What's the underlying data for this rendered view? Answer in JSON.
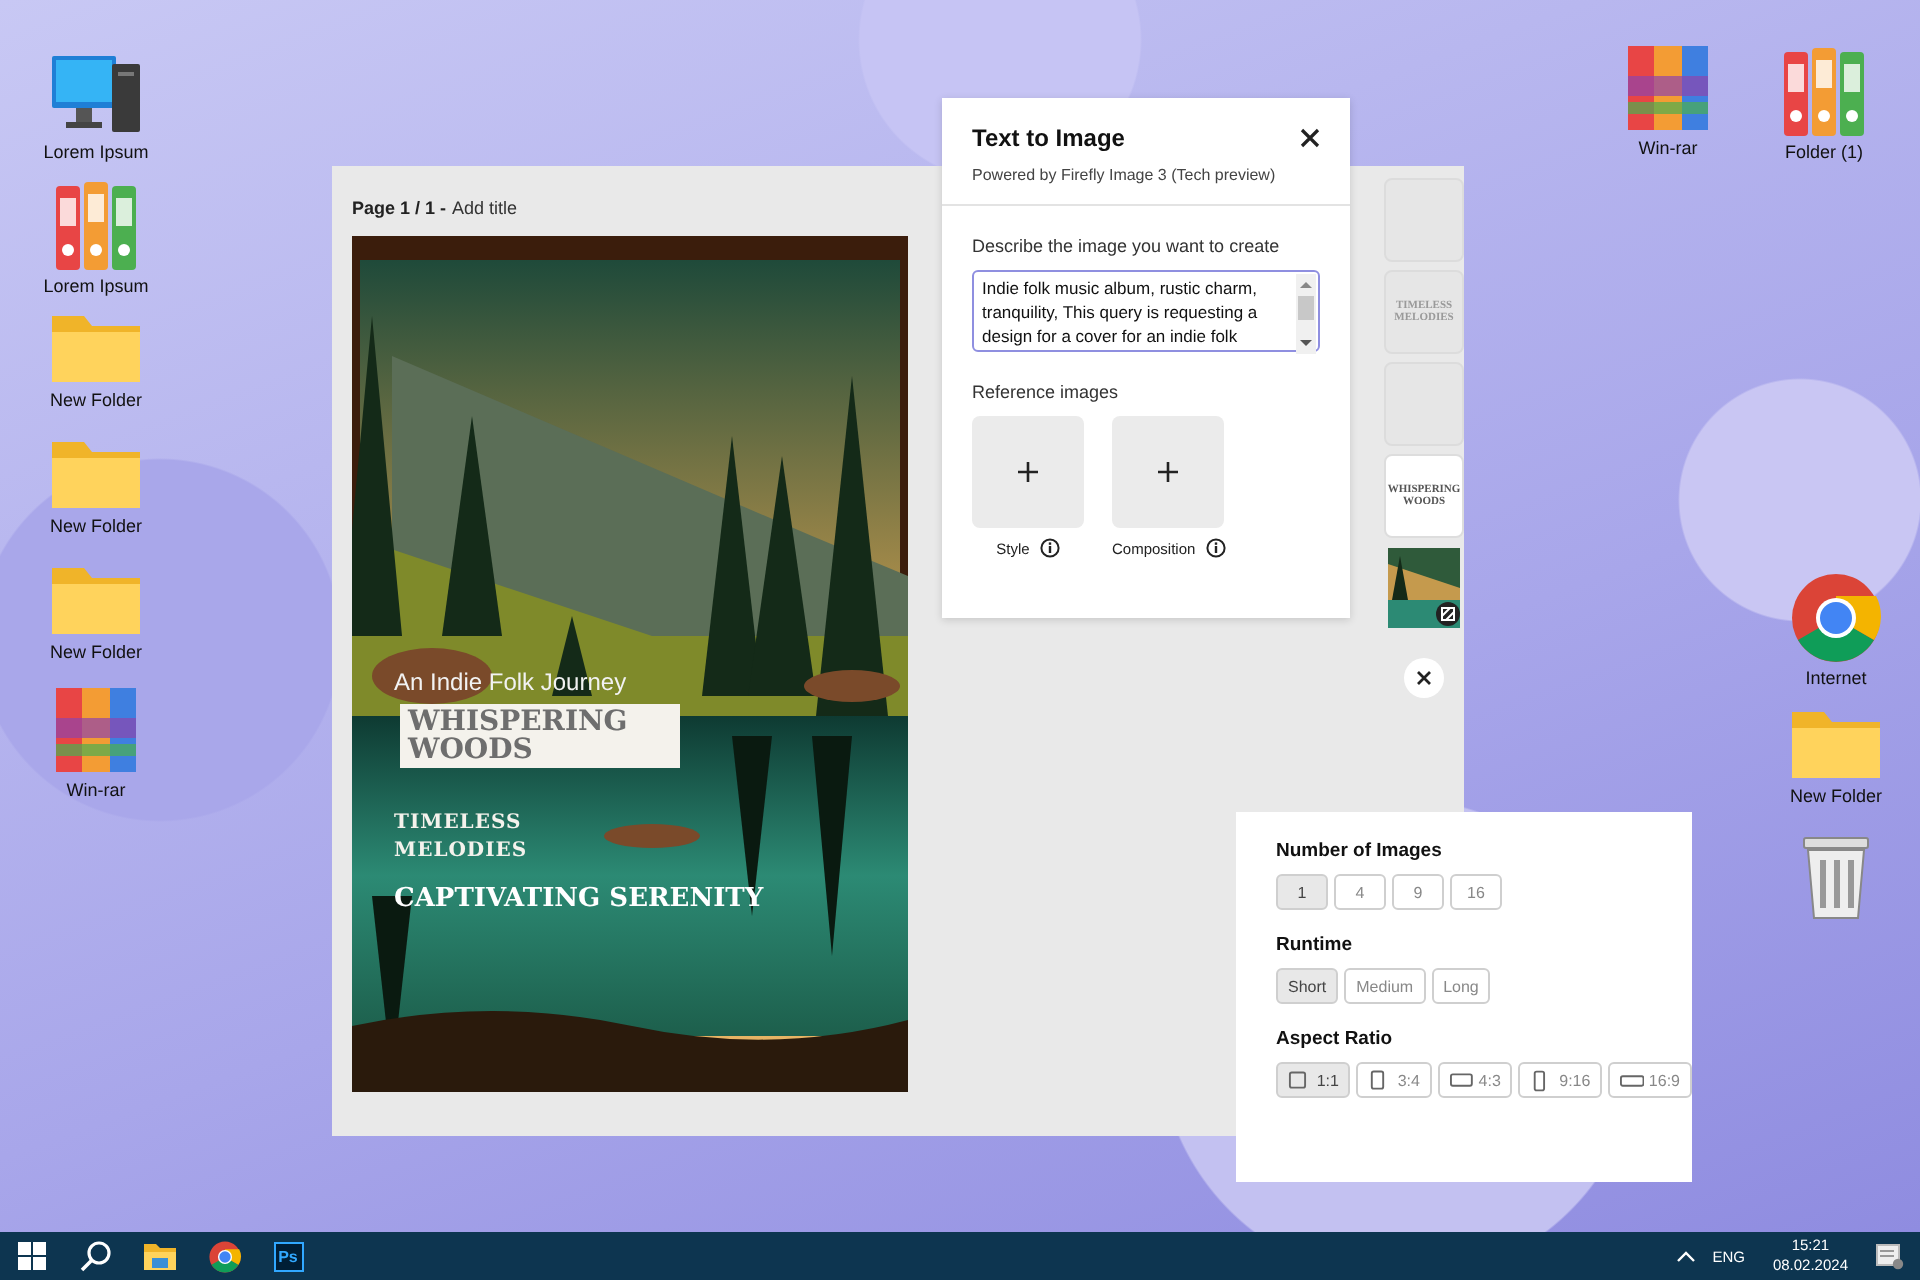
{
  "desktop": {
    "left_icons": [
      {
        "kind": "computer",
        "label": "Lorem Ipsum"
      },
      {
        "kind": "binders",
        "label": "Lorem Ipsum"
      },
      {
        "kind": "folder",
        "label": "New Folder"
      },
      {
        "kind": "folder",
        "label": "New Folder"
      },
      {
        "kind": "folder",
        "label": "New Folder"
      },
      {
        "kind": "books",
        "label": "Win-rar"
      }
    ],
    "top_right_icons": [
      {
        "kind": "books",
        "label": "Win-rar"
      },
      {
        "kind": "binders",
        "label": "Folder (1)"
      }
    ],
    "right_icons": [
      {
        "kind": "chrome",
        "label": "Internet"
      },
      {
        "kind": "folder",
        "label": "New Folder"
      },
      {
        "kind": "bin"
      }
    ]
  },
  "editor": {
    "page_label": "Page 1 / 1 -",
    "title_placeholder": "Add title",
    "cover": {
      "subtitle": "An Indie Folk Journey",
      "title": "WHISPERING WOODS",
      "tagline": "TIMELESS MELODIES",
      "headline": "CAPTIVATING SERENITY"
    },
    "thumbnails": [
      {
        "kind": "blank",
        "dimmed": true
      },
      {
        "kind": "text",
        "text": "TIMELESS MELODIES",
        "dimmed": true
      },
      {
        "kind": "blank",
        "dimmed": true
      },
      {
        "kind": "text",
        "text": "WHISPERING WOODS",
        "dimmed": false
      },
      {
        "kind": "image",
        "dimmed": false
      }
    ]
  },
  "text_to_image": {
    "title": "Text to Image",
    "subtitle": "Powered by Firefly Image 3 (Tech preview)",
    "prompt_label": "Describe the image you want to create",
    "prompt_value": "Indie folk music album, rustic charm, tranquility, This query is requesting a design for a cover for an indie folk",
    "reference_label": "Reference images",
    "references": [
      {
        "label": "Style"
      },
      {
        "label": "Composition"
      }
    ]
  },
  "settings": {
    "groups": [
      {
        "label": "Number of Images",
        "options": [
          {
            "label": "1",
            "selected": true
          },
          {
            "label": "4",
            "selected": false
          },
          {
            "label": "9",
            "selected": false
          },
          {
            "label": "16",
            "selected": false
          }
        ]
      },
      {
        "label": "Runtime",
        "options": [
          {
            "label": "Short",
            "selected": true
          },
          {
            "label": "Medium",
            "selected": false
          },
          {
            "label": "Long",
            "selected": false
          }
        ]
      },
      {
        "label": "Aspect Ratio",
        "options": [
          {
            "label": "1:1",
            "kind": "square",
            "selected": true
          },
          {
            "label": "3:4",
            "kind": "portrait",
            "selected": false
          },
          {
            "label": "4:3",
            "kind": "landscape",
            "selected": false
          },
          {
            "label": "9:16",
            "kind": "tall",
            "selected": false
          },
          {
            "label": "16:9",
            "kind": "wide",
            "selected": false
          }
        ]
      }
    ]
  },
  "taskbar": {
    "apps": [
      {
        "kind": "start"
      },
      {
        "kind": "search"
      },
      {
        "kind": "explorer"
      },
      {
        "kind": "chrome"
      },
      {
        "kind": "photoshop",
        "text": "Ps"
      }
    ],
    "language": "ENG",
    "time": "15:21",
    "date": "08.02.2024"
  }
}
